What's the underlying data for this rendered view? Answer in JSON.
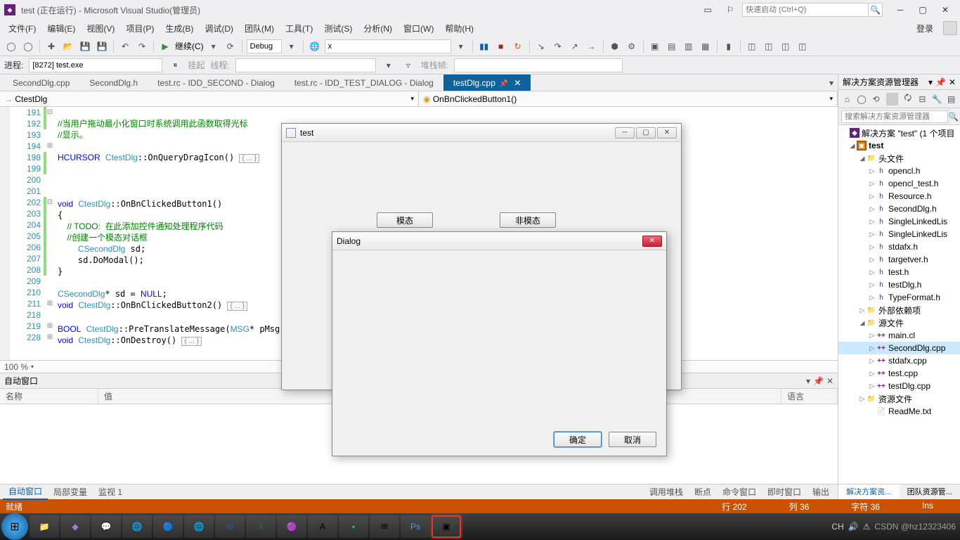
{
  "titlebar": {
    "title": "test (正在运行) - Microsoft Visual Studio(管理员)",
    "quick_launch_placeholder": "快速启动 (Ctrl+Q)"
  },
  "menu": {
    "file": "文件(F)",
    "edit": "编辑(E)",
    "view": "视图(V)",
    "project": "项目(P)",
    "build": "生成(B)",
    "debug": "调试(D)",
    "team": "团队(M)",
    "tools": "工具(T)",
    "test": "测试(S)",
    "analyze": "分析(N)",
    "window": "窗口(W)",
    "help": "帮助(H)",
    "login": "登录"
  },
  "toolbar": {
    "continue": "继续(C)",
    "config": "Debug",
    "platform": "x"
  },
  "toolbar2": {
    "process_label": "进程:",
    "process_value": "[8272] test.exe",
    "suspend": "挂起",
    "thread_label": "线程:",
    "stackframe_label": "堆栈帧:"
  },
  "tabs": [
    {
      "label": "SecondDlg.cpp"
    },
    {
      "label": "SecondDlg.h"
    },
    {
      "label": "test.rc - IDD_SECOND - Dialog"
    },
    {
      "label": "test.rc - IDD_TEST_DIALOG - Dialog"
    },
    {
      "label": "testDlg.cpp",
      "active": true
    }
  ],
  "navbar": {
    "scope": "CtestDlg",
    "member": "OnBnClickedButton1()"
  },
  "code": {
    "lines": [
      191,
      192,
      193,
      194,
      198,
      199,
      200,
      201,
      202,
      203,
      204,
      205,
      206,
      207,
      208,
      209,
      210,
      211,
      218,
      219,
      228
    ],
    "l191": "//当用户拖动最小化窗口时系统调用此函数取得光标",
    "l192": "//显示。",
    "l193_sig": "HCURSOR CtestDlg::OnQueryDragIcon()",
    "collapsed": "{ ... }",
    "l202_sig": "void CtestDlg::OnBnClickedButton1()",
    "l203": "{",
    "l204": "    // TODO:  在此添加控件通知处理程序代码",
    "l205": "    //创建一个模态对话框",
    "l206": "    CSecondDlg sd;",
    "l207": "    sd.DoModal();",
    "l208": "}",
    "l210": "CSecondDlg* sd = NULL;",
    "l211_sig": "void CtestDlg::OnBnClickedButton2()",
    "l219_sig": "BOOL CtestDlg::PreTranslateMessage(MSG* pMsg)",
    "l228_sig": "void CtestDlg::OnDestroy()"
  },
  "zoom": "100 %",
  "autos_panel": {
    "title": "自动窗口",
    "cols": {
      "name": "名称",
      "value": "值",
      "type": "语言"
    }
  },
  "bottom_tabs": {
    "autos": "自动窗口",
    "locals": "局部变量",
    "watch": "监视 1",
    "callstack": "调用堆栈",
    "breakpoints": "断点",
    "command": "命令窗口",
    "immediate": "即时窗口",
    "output": "输出"
  },
  "solution": {
    "title": "解决方案资源管理器",
    "search_placeholder": "搜索解决方案资源管理器",
    "root": "解决方案 \"test\" (1 个项目",
    "project": "test",
    "folders": {
      "headers": "头文件",
      "external": "外部依赖项",
      "sources": "源文件",
      "resources": "资源文件"
    },
    "headers": [
      "opencl.h",
      "opencl_test.h",
      "Resource.h",
      "SecondDlg.h",
      "SingleLinkedLis",
      "SingleLinkedLis",
      "stdafx.h",
      "targetver.h",
      "test.h",
      "testDlg.h",
      "TypeFormat.h"
    ],
    "sources": [
      "main.cl",
      "SecondDlg.cpp",
      "stdafx.cpp",
      "test.cpp",
      "testDlg.cpp"
    ],
    "readme": "ReadMe.txt",
    "bottom_tabs": {
      "sln": "解决方案资...",
      "team": "团队资源管..."
    }
  },
  "status": {
    "ready": "就绪",
    "line": "行 202",
    "col": "列 36",
    "char": "字符 36",
    "ins": "Ins"
  },
  "test_window": {
    "title": "test",
    "btn_modal": "模态",
    "btn_modeless": "非模态"
  },
  "dialog_window": {
    "title": "Dialog",
    "ok": "确定",
    "cancel": "取消"
  },
  "tray": {
    "ime": "CH",
    "watermark": "CSDN @hz12323406"
  }
}
